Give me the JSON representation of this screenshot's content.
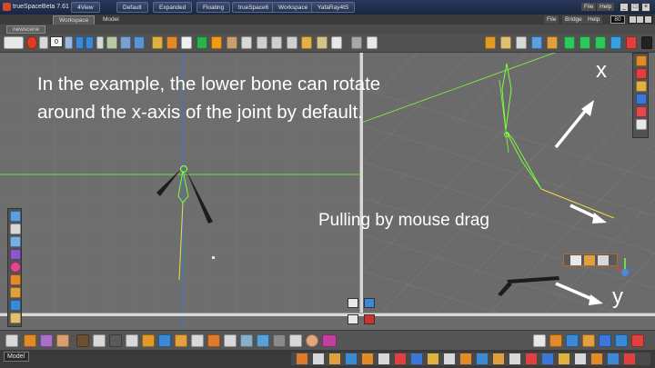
{
  "window": {
    "title": "trueSpaceBeta 7.61",
    "layouts": [
      "4View",
      "Default",
      "Expanded",
      "Floating",
      "trueSpace6",
      "Workspace",
      "YafaRay4tS"
    ],
    "min_symbol": "_",
    "max_symbol": "□",
    "close_symbol": "×"
  },
  "tabs": {
    "doc_tabs": [
      "Workspace",
      "Model"
    ],
    "menu": [
      "File",
      "Help"
    ],
    "menu_right": [
      "File",
      "Bridge",
      "Help"
    ],
    "fps": "80"
  },
  "scene": {
    "tab_label": "newscene"
  },
  "toolbar": {
    "frame_value": "0"
  },
  "annotations": {
    "main_line1": "In the example, the lower bone can rotate",
    "main_line2": "around the x-axis of the joint by default.",
    "drag_caption": "Pulling by mouse drag",
    "axis_x": "x",
    "axis_y": "y"
  },
  "status": {
    "mode_label": "Model"
  },
  "colors": {
    "axis_green": "#7cff3a",
    "axis_blue": "#3a78d8",
    "bone_yellow": "#f0e03a",
    "bone_dark": "#1c1c1c"
  }
}
